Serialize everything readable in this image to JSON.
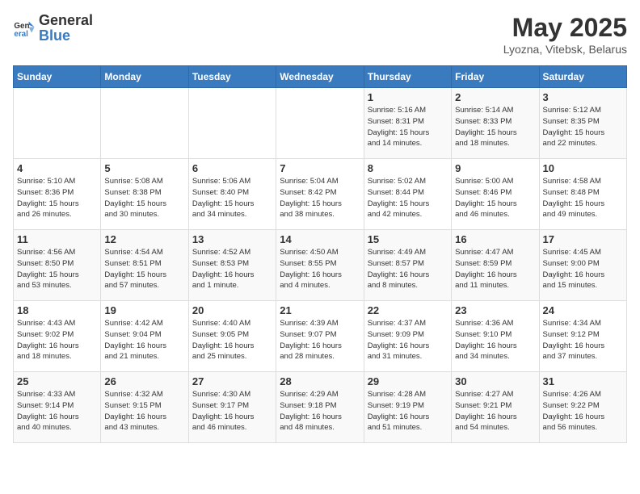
{
  "header": {
    "logo_general": "General",
    "logo_blue": "Blue",
    "month_year": "May 2025",
    "location": "Lyozna, Vitebsk, Belarus"
  },
  "weekdays": [
    "Sunday",
    "Monday",
    "Tuesday",
    "Wednesday",
    "Thursday",
    "Friday",
    "Saturday"
  ],
  "weeks": [
    [
      {
        "day": "",
        "info": ""
      },
      {
        "day": "",
        "info": ""
      },
      {
        "day": "",
        "info": ""
      },
      {
        "day": "",
        "info": ""
      },
      {
        "day": "1",
        "info": "Sunrise: 5:16 AM\nSunset: 8:31 PM\nDaylight: 15 hours\nand 14 minutes."
      },
      {
        "day": "2",
        "info": "Sunrise: 5:14 AM\nSunset: 8:33 PM\nDaylight: 15 hours\nand 18 minutes."
      },
      {
        "day": "3",
        "info": "Sunrise: 5:12 AM\nSunset: 8:35 PM\nDaylight: 15 hours\nand 22 minutes."
      }
    ],
    [
      {
        "day": "4",
        "info": "Sunrise: 5:10 AM\nSunset: 8:36 PM\nDaylight: 15 hours\nand 26 minutes."
      },
      {
        "day": "5",
        "info": "Sunrise: 5:08 AM\nSunset: 8:38 PM\nDaylight: 15 hours\nand 30 minutes."
      },
      {
        "day": "6",
        "info": "Sunrise: 5:06 AM\nSunset: 8:40 PM\nDaylight: 15 hours\nand 34 minutes."
      },
      {
        "day": "7",
        "info": "Sunrise: 5:04 AM\nSunset: 8:42 PM\nDaylight: 15 hours\nand 38 minutes."
      },
      {
        "day": "8",
        "info": "Sunrise: 5:02 AM\nSunset: 8:44 PM\nDaylight: 15 hours\nand 42 minutes."
      },
      {
        "day": "9",
        "info": "Sunrise: 5:00 AM\nSunset: 8:46 PM\nDaylight: 15 hours\nand 46 minutes."
      },
      {
        "day": "10",
        "info": "Sunrise: 4:58 AM\nSunset: 8:48 PM\nDaylight: 15 hours\nand 49 minutes."
      }
    ],
    [
      {
        "day": "11",
        "info": "Sunrise: 4:56 AM\nSunset: 8:50 PM\nDaylight: 15 hours\nand 53 minutes."
      },
      {
        "day": "12",
        "info": "Sunrise: 4:54 AM\nSunset: 8:51 PM\nDaylight: 15 hours\nand 57 minutes."
      },
      {
        "day": "13",
        "info": "Sunrise: 4:52 AM\nSunset: 8:53 PM\nDaylight: 16 hours\nand 1 minute."
      },
      {
        "day": "14",
        "info": "Sunrise: 4:50 AM\nSunset: 8:55 PM\nDaylight: 16 hours\nand 4 minutes."
      },
      {
        "day": "15",
        "info": "Sunrise: 4:49 AM\nSunset: 8:57 PM\nDaylight: 16 hours\nand 8 minutes."
      },
      {
        "day": "16",
        "info": "Sunrise: 4:47 AM\nSunset: 8:59 PM\nDaylight: 16 hours\nand 11 minutes."
      },
      {
        "day": "17",
        "info": "Sunrise: 4:45 AM\nSunset: 9:00 PM\nDaylight: 16 hours\nand 15 minutes."
      }
    ],
    [
      {
        "day": "18",
        "info": "Sunrise: 4:43 AM\nSunset: 9:02 PM\nDaylight: 16 hours\nand 18 minutes."
      },
      {
        "day": "19",
        "info": "Sunrise: 4:42 AM\nSunset: 9:04 PM\nDaylight: 16 hours\nand 21 minutes."
      },
      {
        "day": "20",
        "info": "Sunrise: 4:40 AM\nSunset: 9:05 PM\nDaylight: 16 hours\nand 25 minutes."
      },
      {
        "day": "21",
        "info": "Sunrise: 4:39 AM\nSunset: 9:07 PM\nDaylight: 16 hours\nand 28 minutes."
      },
      {
        "day": "22",
        "info": "Sunrise: 4:37 AM\nSunset: 9:09 PM\nDaylight: 16 hours\nand 31 minutes."
      },
      {
        "day": "23",
        "info": "Sunrise: 4:36 AM\nSunset: 9:10 PM\nDaylight: 16 hours\nand 34 minutes."
      },
      {
        "day": "24",
        "info": "Sunrise: 4:34 AM\nSunset: 9:12 PM\nDaylight: 16 hours\nand 37 minutes."
      }
    ],
    [
      {
        "day": "25",
        "info": "Sunrise: 4:33 AM\nSunset: 9:14 PM\nDaylight: 16 hours\nand 40 minutes."
      },
      {
        "day": "26",
        "info": "Sunrise: 4:32 AM\nSunset: 9:15 PM\nDaylight: 16 hours\nand 43 minutes."
      },
      {
        "day": "27",
        "info": "Sunrise: 4:30 AM\nSunset: 9:17 PM\nDaylight: 16 hours\nand 46 minutes."
      },
      {
        "day": "28",
        "info": "Sunrise: 4:29 AM\nSunset: 9:18 PM\nDaylight: 16 hours\nand 48 minutes."
      },
      {
        "day": "29",
        "info": "Sunrise: 4:28 AM\nSunset: 9:19 PM\nDaylight: 16 hours\nand 51 minutes."
      },
      {
        "day": "30",
        "info": "Sunrise: 4:27 AM\nSunset: 9:21 PM\nDaylight: 16 hours\nand 54 minutes."
      },
      {
        "day": "31",
        "info": "Sunrise: 4:26 AM\nSunset: 9:22 PM\nDaylight: 16 hours\nand 56 minutes."
      }
    ]
  ]
}
